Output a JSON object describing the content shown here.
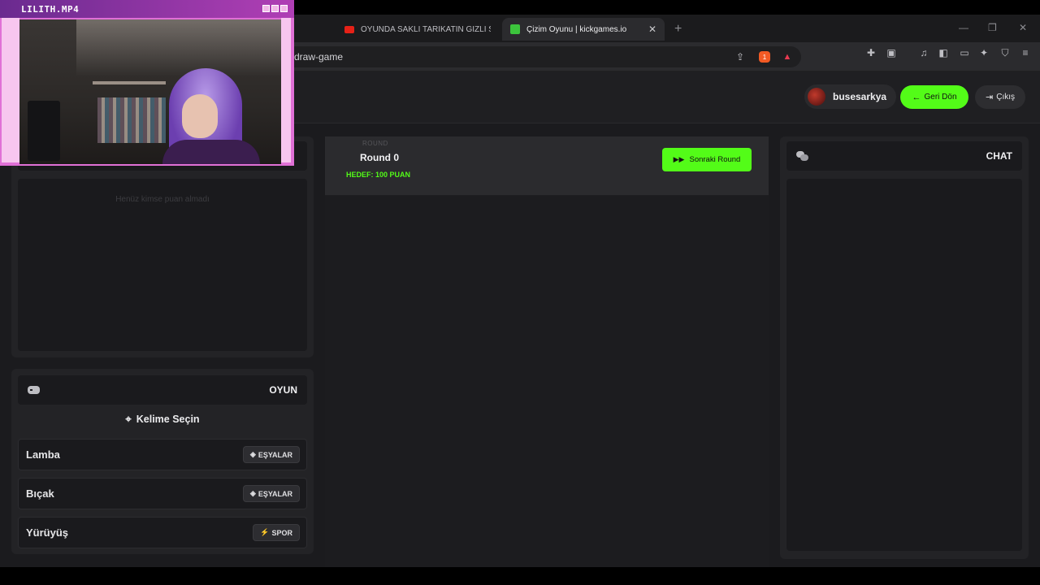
{
  "browser": {
    "tabs": [
      {
        "label": "OYUNDA SAKLI TARİKATIN GİZLİ SIRLARI",
        "active": false
      },
      {
        "label": "Çizim Oyunu | kickgames.io",
        "active": true
      }
    ],
    "url": "draw-game",
    "brave_badge": "1"
  },
  "header": {
    "username": "busesarkya",
    "back_label": "Geri Dön",
    "exit_label": "Çıkış"
  },
  "scoreboard": {
    "empty_text": "Henüz kimse puan almadı"
  },
  "game_panel": {
    "title": "OYUN",
    "choose_label": "Kelime Seçin",
    "words": [
      {
        "word": "Lamba",
        "category": "EŞYALAR",
        "category_icon": "cube-icon"
      },
      {
        "word": "Bıçak",
        "category": "EŞYALAR",
        "category_icon": "cube-icon"
      },
      {
        "word": "Yürüyüş",
        "category": "SPOR",
        "category_icon": "running-icon"
      }
    ]
  },
  "round": {
    "sublabel": "ROUND",
    "title": "Round 0",
    "target": "HEDEF: 100 PUAN",
    "next_label": "Sonraki Round"
  },
  "chat": {
    "title": "CHAT"
  },
  "webcam": {
    "title": "LILITH.MP4"
  },
  "colors": {
    "accent": "#53fc18",
    "page_bg": "#1b1b1e",
    "panel_bg": "#232326",
    "webcam_frame": "#e070d6"
  }
}
